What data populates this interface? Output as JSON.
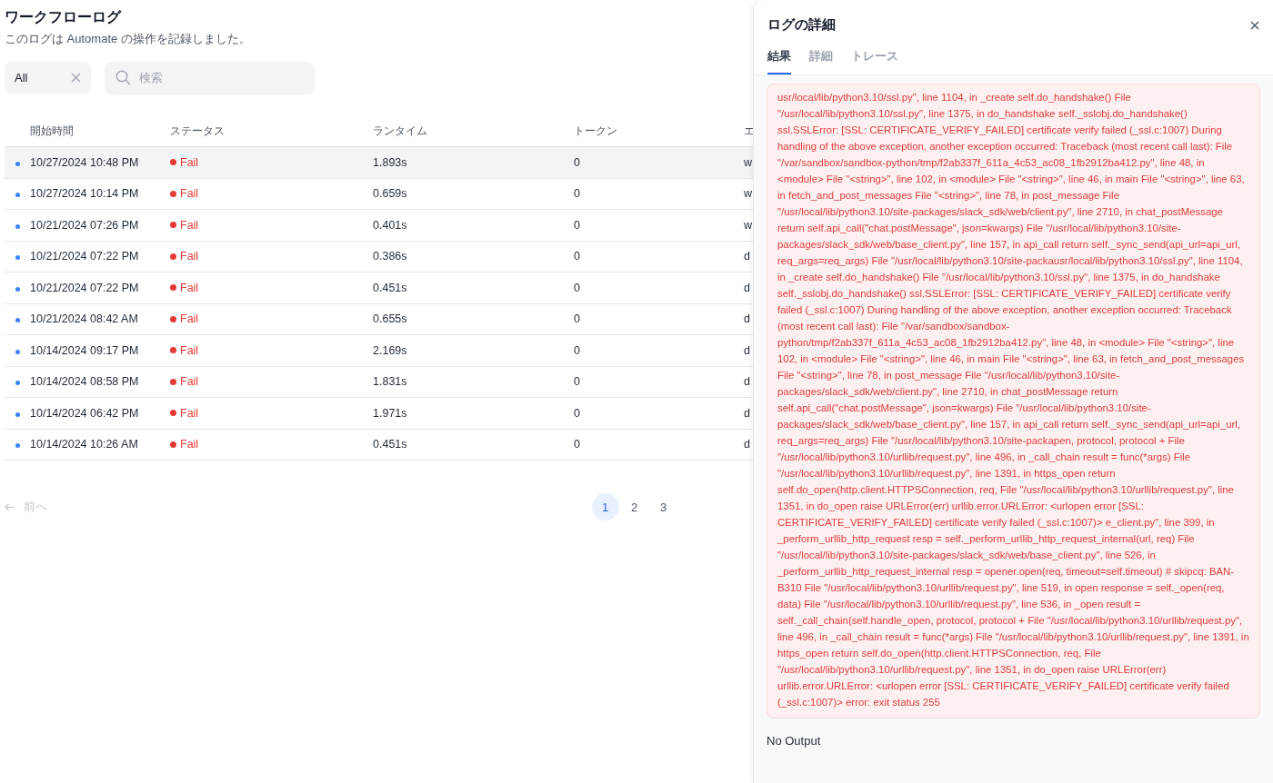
{
  "page": {
    "title": "ワークフローログ",
    "subtitle": "このログは Automate の操作を記録しました。"
  },
  "filter": {
    "value": "All"
  },
  "search": {
    "placeholder": "検索"
  },
  "table": {
    "columns": [
      "開始時間",
      "ステータス",
      "ランタイム",
      "トークン",
      "エ"
    ],
    "rows": [
      {
        "selected": true,
        "start": "10/27/2024 10:48 PM",
        "status": "Fail",
        "color": "#e53935",
        "runtime": "1.893s",
        "tokens": "0",
        "column_5": "w"
      },
      {
        "selected": false,
        "start": "10/27/2024 10:14 PM",
        "status": "Fail",
        "color": "#e53935",
        "runtime": "0.659s",
        "tokens": "0",
        "column_5": "w"
      },
      {
        "selected": false,
        "start": "10/21/2024 07:26 PM",
        "status": "Fail",
        "color": "#e53935",
        "runtime": "0.401s",
        "tokens": "0",
        "column_5": "w"
      },
      {
        "selected": false,
        "start": "10/21/2024 07:22 PM",
        "status": "Fail",
        "color": "#e53935",
        "runtime": "0.386s",
        "tokens": "0",
        "column_5": "d"
      },
      {
        "selected": false,
        "start": "10/21/2024 07:22 PM",
        "status": "Fail",
        "color": "#e53935",
        "runtime": "0.451s",
        "tokens": "0",
        "column_5": "d"
      },
      {
        "selected": false,
        "start": "10/21/2024 08:42 AM",
        "status": "Fail",
        "color": "#e53935",
        "runtime": "0.655s",
        "tokens": "0",
        "column_5": "d"
      },
      {
        "selected": false,
        "start": "10/14/2024 09:17 PM",
        "status": "Fail",
        "color": "#e53935",
        "runtime": "2.169s",
        "tokens": "0",
        "column_5": "d"
      },
      {
        "selected": false,
        "start": "10/14/2024 08:58 PM",
        "status": "Fail",
        "color": "#e53935",
        "runtime": "1.831s",
        "tokens": "0",
        "column_5": "d"
      },
      {
        "selected": false,
        "start": "10/14/2024 06:42 PM",
        "status": "Fail",
        "color": "#e53935",
        "runtime": "1.971s",
        "tokens": "0",
        "column_5": "d"
      },
      {
        "selected": false,
        "start": "10/14/2024 10:26 AM",
        "status": "Fail",
        "color": "#e53935",
        "runtime": "0.451s",
        "tokens": "0",
        "column_5": "d"
      }
    ]
  },
  "pagination": {
    "previous": {
      "label": "前へ",
      "disabled": true
    },
    "pages": [
      {
        "label": "1",
        "selected": true
      },
      {
        "label": "2",
        "selected": false
      },
      {
        "label": "3",
        "selected": false
      }
    ]
  },
  "detail_panel": {
    "title": "ログの詳細",
    "tabs": [
      {
        "label": "結果",
        "selected": true
      },
      {
        "label": "詳細",
        "selected": false
      },
      {
        "label": "トレース",
        "selected": false
      }
    ],
    "error_text": "usr/local/lib/python3.10/ssl.py\", line 1104, in _create self.do_handshake() File \"/usr/local/lib/python3.10/ssl.py\", line 1375, in do_handshake self._sslobj.do_handshake() ssl.SSLError: [SSL: CERTIFICATE_VERIFY_FAILED] certificate verify failed (_ssl.c:1007) During handling of the above exception, another exception occurred: Traceback (most recent call last): File \"/var/sandbox/sandbox-python/tmp/f2ab337f_611a_4c53_ac08_1fb2912ba412.py\", line 48, in <module> File \"<string>\", line 102, in <module> File \"<string>\", line 46, in main File \"<string>\", line 63, in fetch_and_post_messages File \"<string>\", line 78, in post_message File \"/usr/local/lib/python3.10/site-packages/slack_sdk/web/client.py\", line 2710, in chat_postMessage return self.api_call(\"chat.postMessage\", json=kwargs) File \"/usr/local/lib/python3.10/site-packages/slack_sdk/web/base_client.py\", line 157, in api_call return self._sync_send(api_url=api_url, req_args=req_args) File \"/usr/local/lib/python3.10/site-packausr/local/lib/python3.10/ssl.py\", line 1104, in _create self.do_handshake() File \"/usr/local/lib/python3.10/ssl.py\", line 1375, in do_handshake self._sslobj.do_handshake() ssl.SSLError: [SSL: CERTIFICATE_VERIFY_FAILED] certificate verify failed (_ssl.c:1007) During handling of the above exception, another exception occurred: Traceback (most recent call last): File \"/var/sandbox/sandbox-python/tmp/f2ab337f_611a_4c53_ac08_1fb2912ba412.py\", line 48, in <module> File \"<string>\", line 102, in <module> File \"<string>\", line 46, in main File \"<string>\", line 63, in fetch_and_post_messages File \"<string>\", line 78, in post_message File \"/usr/local/lib/python3.10/site-packages/slack_sdk/web/client.py\", line 2710, in chat_postMessage return self.api_call(\"chat.postMessage\", json=kwargs) File \"/usr/local/lib/python3.10/site-packages/slack_sdk/web/base_client.py\", line 157, in api_call return self._sync_send(api_url=api_url, req_args=req_args) File \"/usr/local/lib/python3.10/site-packapen, protocol, protocol + File \"/usr/local/lib/python3.10/urllib/request.py\", line 496, in _call_chain result = func(*args) File \"/usr/local/lib/python3.10/urllib/request.py\", line 1391, in https_open return self.do_open(http.client.HTTPSConnection, req, File \"/usr/local/lib/python3.10/urllib/request.py\", line 1351, in do_open raise URLError(err) urllib.error.URLError: <urlopen error [SSL: CERTIFICATE_VERIFY_FAILED] certificate verify failed (_ssl.c:1007)> e_client.py\", line 399, in _perform_urllib_http_request resp = self._perform_urllib_http_request_internal(url, req) File \"/usr/local/lib/python3.10/site-packages/slack_sdk/web/base_client.py\", line 526, in _perform_urllib_http_request_internal resp = opener.open(req, timeout=self.timeout) # skipcq: BAN-B310 File \"/usr/local/lib/python3.10/urllib/request.py\", line 519, in open response = self._open(req, data) File \"/usr/local/lib/python3.10/urllib/request.py\", line 536, in _open result = self._call_chain(self.handle_open, protocol, protocol + File \"/usr/local/lib/python3.10/urllib/request.py\", line 496, in _call_chain result = func(*args) File \"/usr/local/lib/python3.10/urllib/request.py\", line 1391, in https_open return self.do_open(http.client.HTTPSConnection, req, File \"/usr/local/lib/python3.10/urllib/request.py\", line 1351, in do_open raise URLError(err) urllib.error.URLError: <urlopen error [SSL: CERTIFICATE_VERIFY_FAILED] certificate verify failed (_ssl.c:1007)> error: exit status 255",
    "output": "No Output"
  }
}
